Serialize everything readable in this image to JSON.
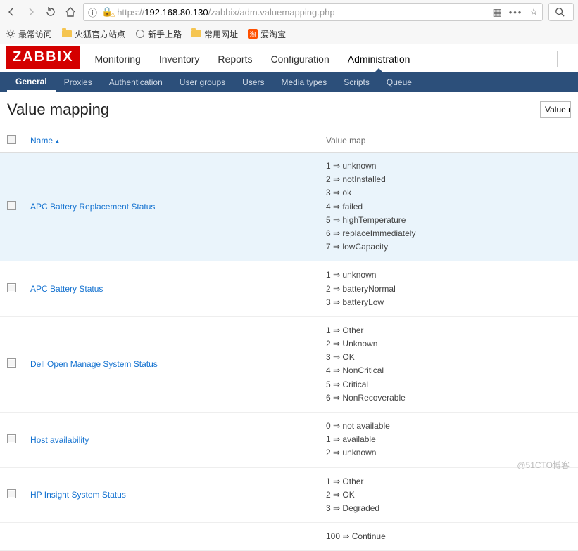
{
  "browser": {
    "url_prefix": "https://",
    "url_host": "192.168.80.130",
    "url_path": "/zabbix/adm.valuemapping.php"
  },
  "bookmarks": [
    {
      "icon": "gear",
      "label": "最常访问"
    },
    {
      "icon": "folder",
      "label": "火狐官方站点"
    },
    {
      "icon": "globe",
      "label": "新手上路"
    },
    {
      "icon": "folder",
      "label": "常用网址"
    },
    {
      "icon": "tao",
      "label": "爱淘宝"
    }
  ],
  "logo": "ZABBIX",
  "main_tabs": [
    "Monitoring",
    "Inventory",
    "Reports",
    "Configuration",
    "Administration"
  ],
  "main_active": 4,
  "subnav": [
    "General",
    "Proxies",
    "Authentication",
    "User groups",
    "Users",
    "Media types",
    "Scripts",
    "Queue"
  ],
  "subnav_active": 0,
  "page_title": "Value mapping",
  "header_button": "Value m",
  "columns": {
    "name": "Name",
    "valuemap": "Value map"
  },
  "rows": [
    {
      "name": "APC Battery Replacement Status",
      "highlight": true,
      "maps": [
        "1 ⇒ unknown",
        "2 ⇒ notInstalled",
        "3 ⇒ ok",
        "4 ⇒ failed",
        "5 ⇒ highTemperature",
        "6 ⇒ replaceImmediately",
        "7 ⇒ lowCapacity"
      ]
    },
    {
      "name": "APC Battery Status",
      "maps": [
        "1 ⇒ unknown",
        "2 ⇒ batteryNormal",
        "3 ⇒ batteryLow"
      ]
    },
    {
      "name": "Dell Open Manage System Status",
      "maps": [
        "1 ⇒ Other",
        "2 ⇒ Unknown",
        "3 ⇒ OK",
        "4 ⇒ NonCritical",
        "5 ⇒ Critical",
        "6 ⇒ NonRecoverable"
      ]
    },
    {
      "name": "Host availability",
      "maps": [
        "0 ⇒ not available",
        "1 ⇒ available",
        "2 ⇒ unknown"
      ]
    },
    {
      "name": "HP Insight System Status",
      "maps": [
        "1 ⇒ Other",
        "2 ⇒ OK",
        "3 ⇒ Degraded"
      ]
    },
    {
      "name": "",
      "maps": [
        "100 ⇒ Continue"
      ]
    }
  ],
  "watermark": "@51CTO博客"
}
